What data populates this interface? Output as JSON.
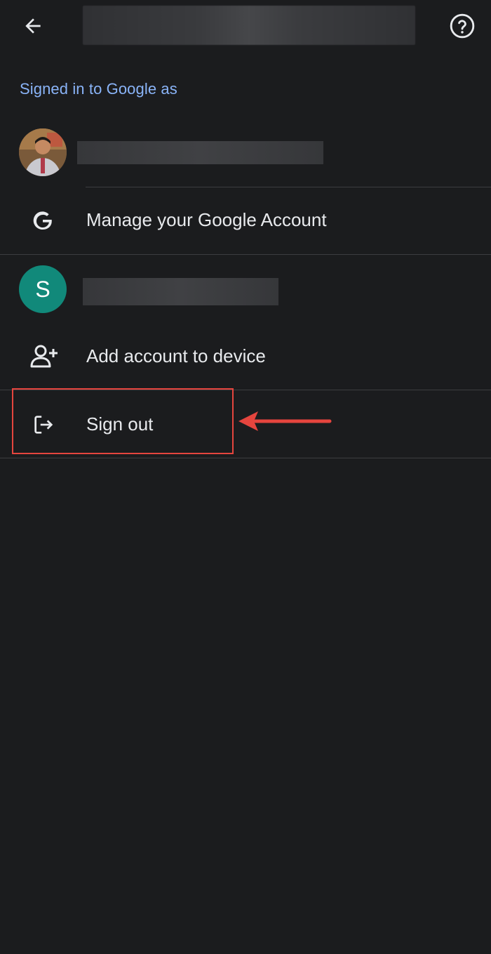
{
  "header": {
    "back_icon": "arrow-back-icon",
    "help_icon": "help-circle-icon"
  },
  "section": {
    "signed_in_label": "Signed in to Google as"
  },
  "accounts": [
    {
      "avatar": "profile-photo"
    },
    {
      "avatar_letter": "S",
      "avatar_color": "#11897a"
    }
  ],
  "menu": {
    "manage_account": {
      "label": "Manage your Google Account",
      "icon": "google-g-icon"
    },
    "add_account": {
      "label": "Add account to device",
      "icon": "person-add-icon"
    },
    "sign_out": {
      "label": "Sign out",
      "icon": "logout-icon"
    }
  },
  "colors": {
    "background": "#1b1c1e",
    "accent_link": "#8ab4f8",
    "annotation": "#e5453e"
  }
}
